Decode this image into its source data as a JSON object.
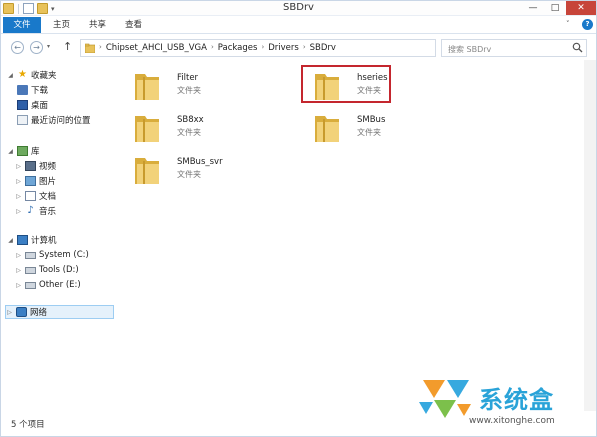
{
  "window": {
    "title": "SBDrv",
    "minimize": "—",
    "maximize": "□",
    "close": "✕"
  },
  "qat": {
    "dropdown": "▾"
  },
  "ribbon": {
    "tabs": [
      "文件",
      "主页",
      "共享",
      "查看"
    ],
    "expand": "˅",
    "help": "?"
  },
  "nav": {
    "back": "←",
    "forward": "→",
    "recent": "▾",
    "up": "↑",
    "path": [
      "Chipset_AHCI_USB_VGA",
      "Packages",
      "Drivers",
      "SBDrv"
    ],
    "path_sep": "›",
    "dropdown": "▾",
    "refresh": "↻",
    "search_placeholder": "搜索 SBDrv"
  },
  "sidebar": {
    "favorites": {
      "label": "收藏夹",
      "items": [
        "下载",
        "桌面",
        "最近访问的位置"
      ]
    },
    "libraries": {
      "label": "库",
      "items": [
        "视频",
        "图片",
        "文档",
        "音乐"
      ]
    },
    "computer": {
      "label": "计算机",
      "items": [
        "System (C:)",
        "Tools (D:)",
        "Other (E:)"
      ]
    },
    "network": {
      "label": "网络"
    }
  },
  "files": [
    {
      "name": "Filter",
      "type": "文件夹"
    },
    {
      "name": "hseries",
      "type": "文件夹"
    },
    {
      "name": "SB8xx",
      "type": "文件夹"
    },
    {
      "name": "SMBus",
      "type": "文件夹"
    },
    {
      "name": "SMBus_svr",
      "type": "文件夹"
    }
  ],
  "status": {
    "count": "5 个项目"
  },
  "watermark": {
    "brand": "系统盒",
    "url": "www.xitonghe.com"
  },
  "colors": {
    "accent": "#1979ca",
    "highlight": "#c4262e",
    "folder": "#e8c25a"
  }
}
